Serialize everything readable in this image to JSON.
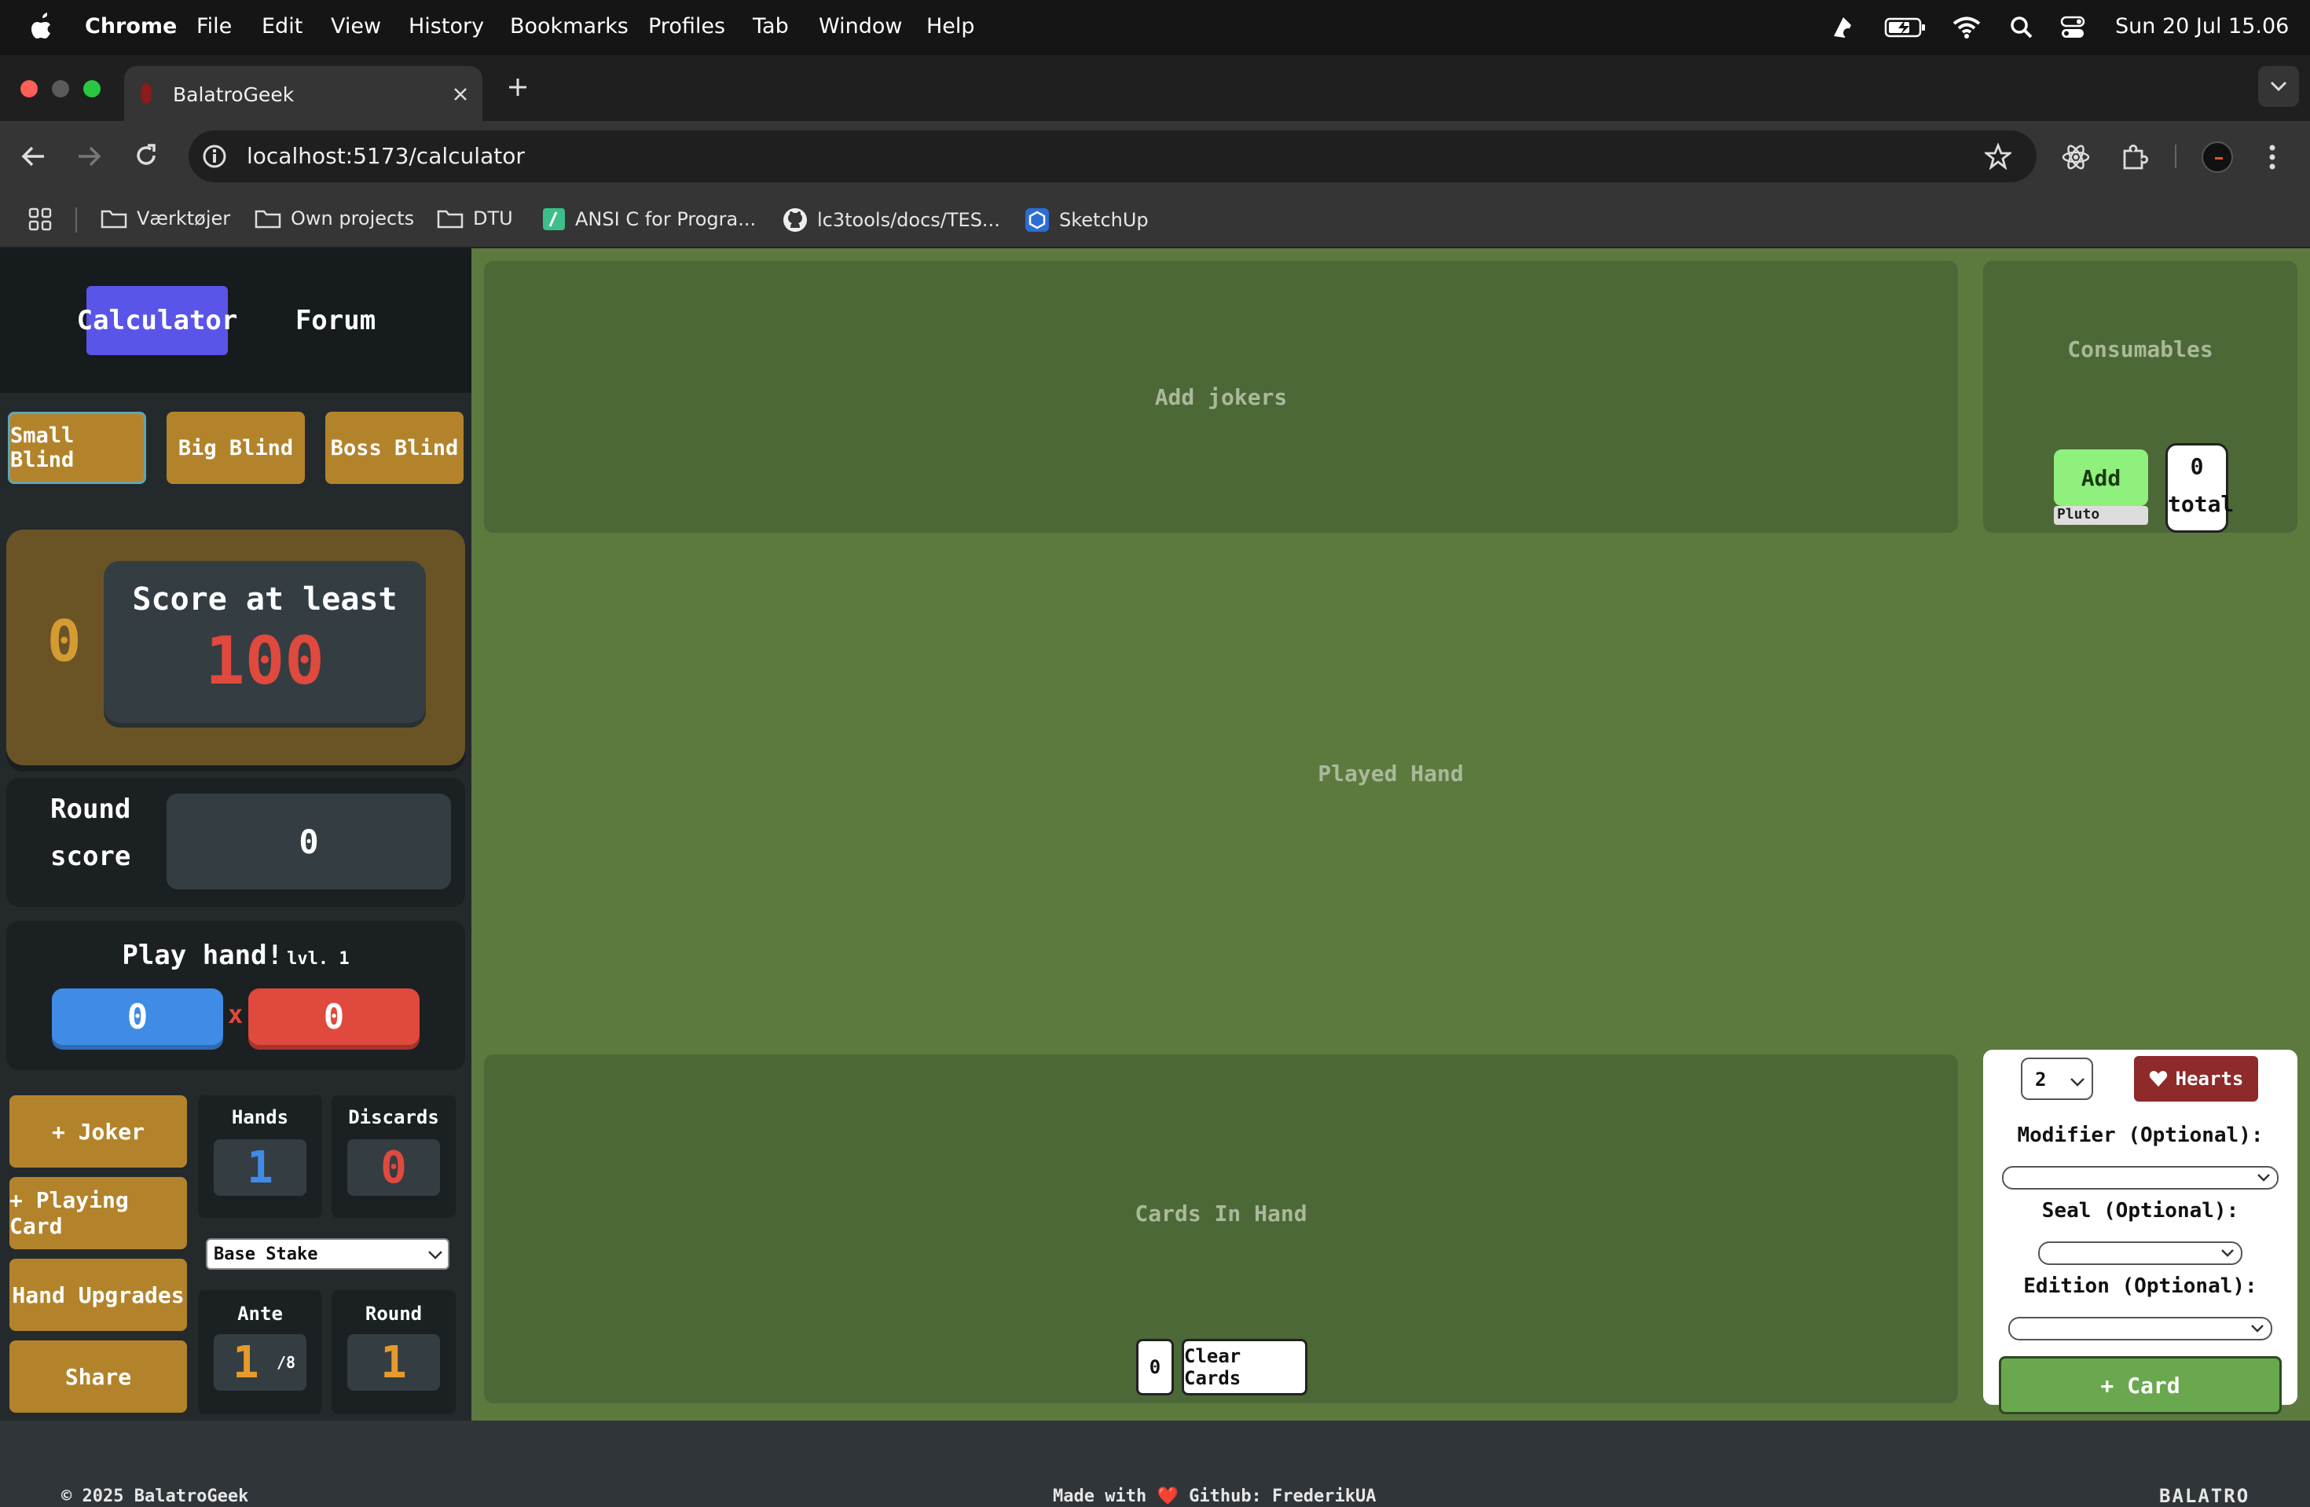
{
  "menubar": {
    "app": "Chrome",
    "items": [
      "File",
      "Edit",
      "View",
      "History",
      "Bookmarks",
      "Profiles",
      "Tab",
      "Window",
      "Help"
    ],
    "clock": "Sun 20 Jul  15.06"
  },
  "tab": {
    "title": "BalatroGeek"
  },
  "address": {
    "url": "localhost:5173/calculator"
  },
  "bookmarks": [
    {
      "label": "Værktøjer"
    },
    {
      "label": "Own projects"
    },
    {
      "label": "DTU"
    },
    {
      "label": "ANSI C for Progra..."
    },
    {
      "label": "lc3tools/docs/TES..."
    },
    {
      "label": "SketchUp"
    }
  ],
  "nav": {
    "calculator": "Calculator",
    "forum": "Forum"
  },
  "blinds": {
    "small": "Small Blind",
    "big": "Big Blind",
    "boss": "Boss Blind"
  },
  "score_panel": {
    "chip_value": "0",
    "label": "Score at least",
    "value": "100"
  },
  "round_score": {
    "label_line1": "Round",
    "label_line2": "score",
    "value": "0"
  },
  "play_hand": {
    "title": "Play hand!",
    "level": "lvl. 1",
    "chips": "0",
    "mult": "0",
    "times": "x"
  },
  "actions": {
    "joker": "+ Joker",
    "playing_card": "+ Playing Card",
    "hand_upgrades": "Hand Upgrades",
    "share": "Share"
  },
  "stats": {
    "hands_label": "Hands",
    "hands_value": "1",
    "discards_label": "Discards",
    "discards_value": "0",
    "stake": "Base Stake",
    "ante_label": "Ante",
    "ante_value": "1",
    "ante_max": "/8",
    "round_label": "Round",
    "round_value": "1"
  },
  "jokers": {
    "placeholder": "Add jokers"
  },
  "consumables": {
    "title": "Consumables",
    "add": "Add",
    "add_sub": "Pluto",
    "count": "0",
    "count_label": "total"
  },
  "played_hand": {
    "placeholder": "Played Hand"
  },
  "cards_in_hand": {
    "placeholder": "Cards In Hand",
    "count": "0",
    "clear": "Clear Cards"
  },
  "card_form": {
    "rank": "2",
    "suit": "Hearts",
    "modifier_label": "Modifier (Optional):",
    "seal_label": "Seal (Optional):",
    "edition_label": "Edition (Optional):",
    "add": "+ Card"
  },
  "footer": {
    "copyright": "© 2025 BalatroGeek",
    "made_with": "Made with ❤️ Github: FrederikUA",
    "logo": "BALATRO"
  },
  "colors": {
    "green_bg": "#5c7a3e",
    "panel": "#4c6837",
    "gold": "#b3832b",
    "blue": "#3f8be6",
    "red": "#e0493d",
    "accent": "#5a55e8"
  }
}
